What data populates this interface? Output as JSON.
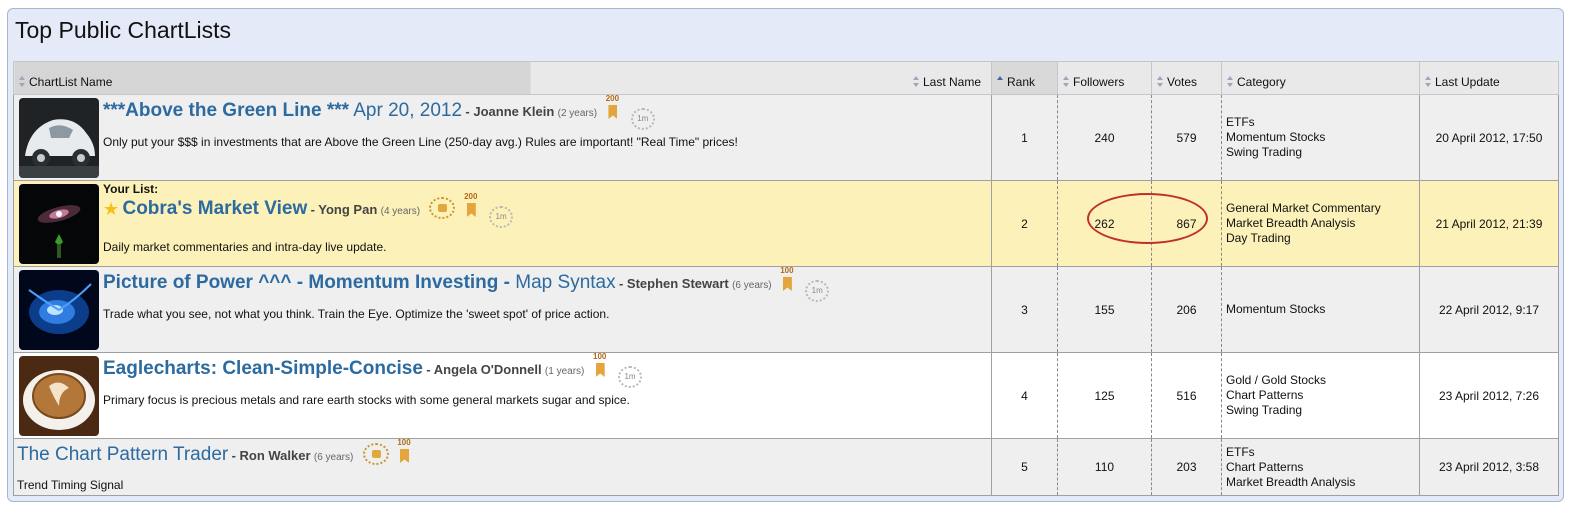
{
  "page": {
    "title": "Top Public ChartLists"
  },
  "columns": {
    "name": "ChartList Name",
    "last_name": "Last Name",
    "rank": "Rank",
    "followers": "Followers",
    "votes": "Votes",
    "category": "Category",
    "last_update": "Last Update"
  },
  "rows": [
    {
      "title_bold": "***Above the Green Line ***",
      "title_light": " Apr 20, 2012",
      "author": "- Joanne Klein",
      "years": "(2 years)",
      "badges": [
        "200",
        "1m"
      ],
      "desc": "Only put your $$$ in investments that are Above the Green Line (250-day avg.) Rules are important! \"Real Time\" prices!",
      "rank": "1",
      "followers": "240",
      "votes": "579",
      "categories": [
        "ETFs",
        "Momentum Stocks",
        "Swing Trading"
      ],
      "last_update": "20 April 2012, 17:50",
      "thumb": "beetle-car-image"
    },
    {
      "your_list": "Your List:",
      "title_bold": "Cobra's Market View",
      "author": "- Yong Pan",
      "years": "(4 years)",
      "badges": [
        "200",
        "1m"
      ],
      "desc": "Daily market commentaries and intra-day live update.",
      "rank": "2",
      "followers": "262",
      "votes": "867",
      "categories": [
        "General Market Commentary",
        "Market Breadth Analysis",
        "Day Trading"
      ],
      "last_update": "21 April 2012, 21:39",
      "thumb": "galaxy-image"
    },
    {
      "title_bold": "Picture of Power ^^^ - Momentum Investing -",
      "title_light": " Map Syntax",
      "author": "- Stephen Stewart",
      "years": "(6 years)",
      "badges": [
        "100",
        "1m"
      ],
      "desc": "Trade what you see, not what you think. Train the Eye. Optimize the 'sweet spot' of price action.",
      "rank": "3",
      "followers": "155",
      "votes": "206",
      "categories": [
        "Momentum Stocks"
      ],
      "last_update": "22 April 2012, 9:17",
      "thumb": "blue-energy-image"
    },
    {
      "title_bold": "Eaglecharts: Clean-Simple-Concise",
      "author": "- Angela O'Donnell",
      "years": "(1 years)",
      "badges": [
        "100",
        "1m"
      ],
      "desc": "Primary focus is precious metals and rare earth stocks with some general markets sugar and spice.",
      "rank": "4",
      "followers": "125",
      "votes": "516",
      "categories": [
        "Gold / Gold Stocks",
        "Chart Patterns",
        "Swing Trading"
      ],
      "last_update": "23 April 2012, 7:26",
      "thumb": "coffee-cup-image"
    },
    {
      "title_light": "The Chart Pattern Trader",
      "author": "- Ron Walker",
      "years": "(6 years)",
      "badges": [
        "100"
      ],
      "desc": "Trend Timing Signal",
      "rank": "5",
      "followers": "110",
      "votes": "203",
      "categories": [
        "ETFs",
        "Chart Patterns",
        "Market Breadth Analysis"
      ],
      "last_update": "23 April 2012, 3:58"
    }
  ]
}
